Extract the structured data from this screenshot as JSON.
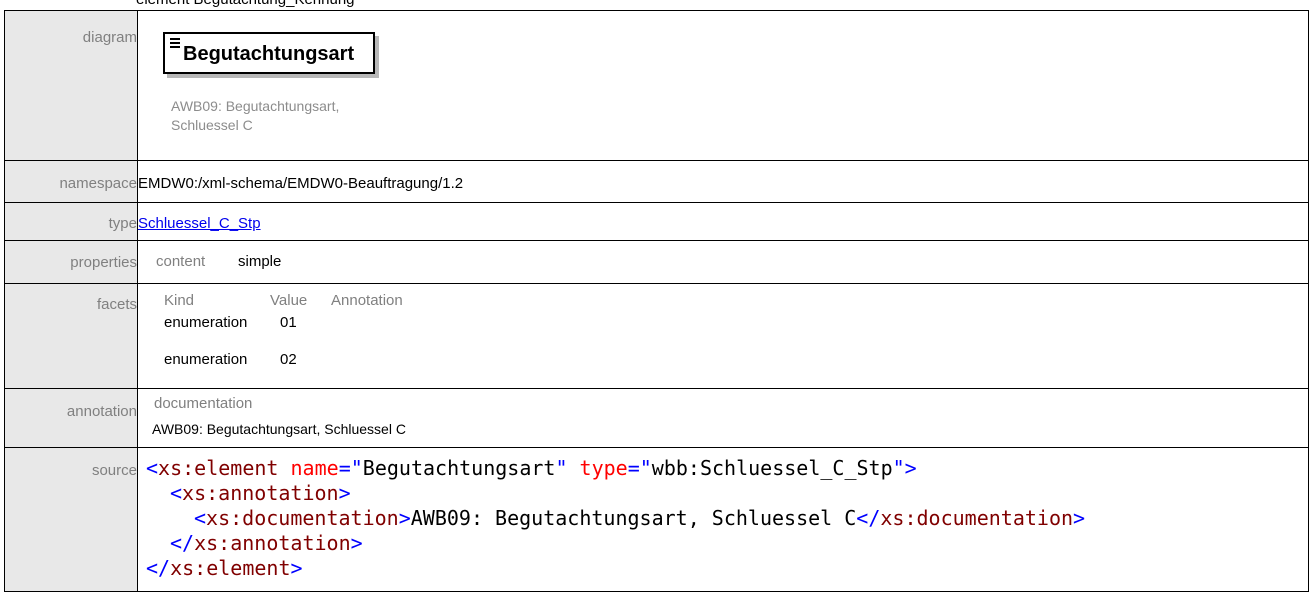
{
  "cut_heading": "element Begutachtung_Kennung",
  "labels": {
    "diagram": "diagram",
    "namespace": "namespace",
    "type": "type",
    "properties": "properties",
    "facets": "facets",
    "annotation": "annotation",
    "source": "source"
  },
  "diagram": {
    "element_name": "Begutachtungsart",
    "annotation_line1": "AWB09: Begutachtungsart,",
    "annotation_line2": "Schluessel C",
    "icon": "element-lines-icon"
  },
  "namespace_value": "EMDW0:/xml-schema/EMDW0-Beauftragung/1.2",
  "type_link": "Schluessel_C_Stp",
  "properties": {
    "key": "content",
    "value": "simple"
  },
  "facets": {
    "headers": [
      "Kind",
      "Value",
      "Annotation"
    ],
    "rows": [
      {
        "kind": "enumeration",
        "value": "01",
        "annotation": ""
      },
      {
        "kind": "enumeration",
        "value": "02",
        "annotation": ""
      }
    ]
  },
  "annotation": {
    "key": "documentation",
    "value": "AWB09: Begutachtungsart, Schluessel C"
  },
  "source": {
    "l1_open": "<xs:element ",
    "l1_attr1": "name",
    "l1_eq1": "=\"",
    "l1_val1": "Begutachtungsart",
    "l1_q1": "\" ",
    "l1_attr2": "type",
    "l1_eq2": "=\"",
    "l1_val2": "wbb:Schluessel_C_Stp",
    "l1_close": "\">",
    "l2": "<xs:annotation>",
    "l3_open": "<xs:documentation>",
    "l3_text": "AWB09: Begutachtungsart, Schluessel C",
    "l3_close": "</xs:documentation>",
    "l4": "</xs:annotation>",
    "l5": "</xs:element>"
  }
}
